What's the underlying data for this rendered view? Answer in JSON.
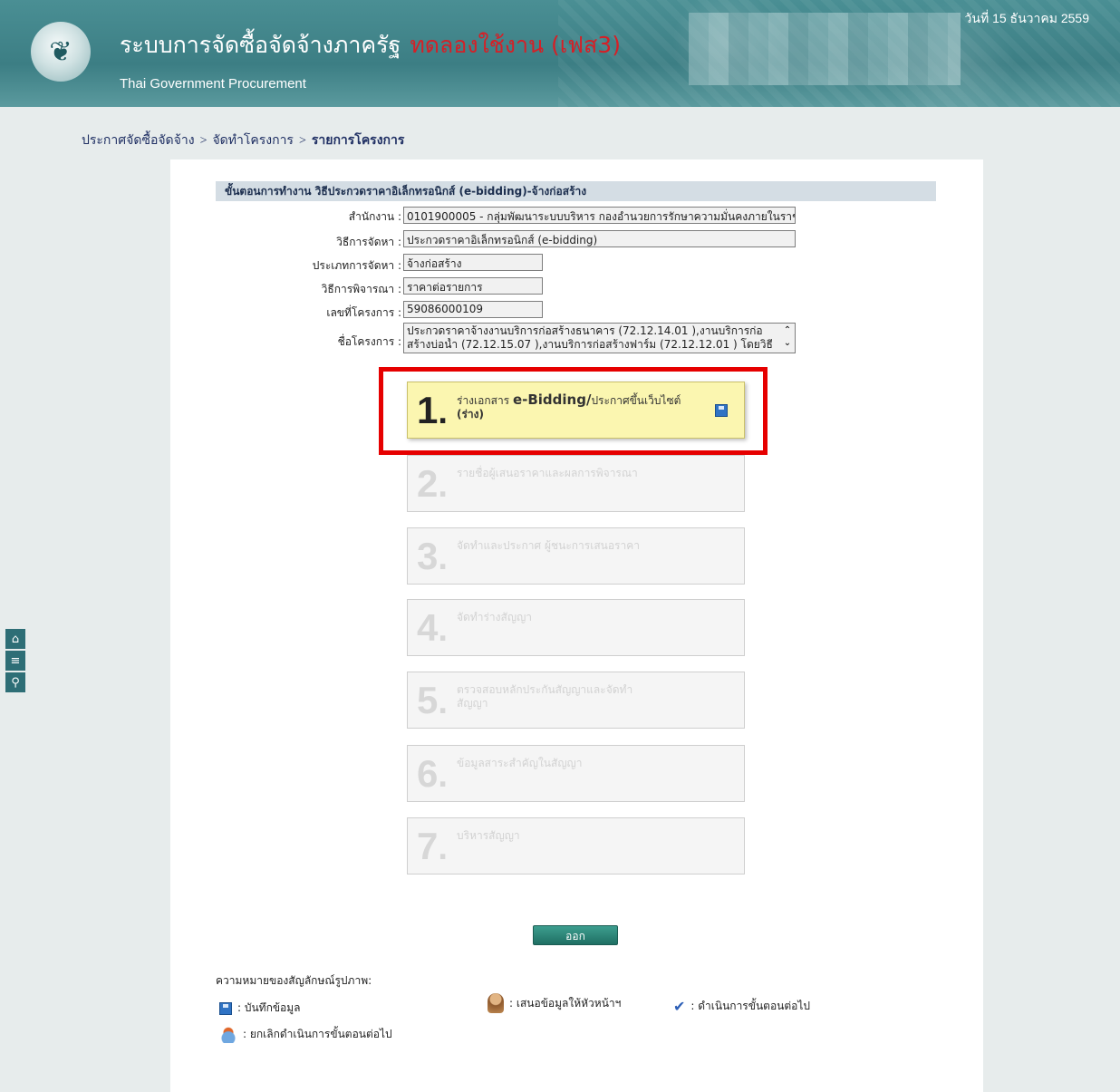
{
  "header": {
    "title_th": "ระบบการจัดซื้อจัดจ้างภาครัฐ",
    "title_trial": "ทดลองใช้งาน (เฟส3)",
    "title_en": "Thai Government Procurement",
    "date": "วันที่ 15 ธันวาคม 2559"
  },
  "breadcrumb": {
    "items": [
      "ประกาศจัดซื้อจัดจ้าง",
      "จัดทำโครงการ",
      "รายการโครงการ"
    ],
    "separator": ">"
  },
  "sidebar": {
    "icons": [
      "home-icon",
      "menu-icon",
      "search-icon"
    ],
    "home_glyph": "⌂",
    "menu_glyph": "≡",
    "search_glyph": "⚲"
  },
  "section": {
    "heading": "ขั้นตอนการทำงาน วิธีประกวดราคาอิเล็กทรอนิกส์ (e-bidding)-จ้างก่อสร้าง"
  },
  "form": {
    "agency_label": "สำนักงาน :",
    "agency_value": "0101900005 - กลุ่มพัฒนาระบบบริหาร กองอำนวยการรักษาความมั่นคงภายในราช",
    "method_label": "วิธีการจัดหา :",
    "method_value": "ประกวดราคาอิเล็กทรอนิกส์ (e-bidding)",
    "type_label": "ประเภทการจัดหา :",
    "type_value": "จ้างก่อสร้าง",
    "consider_label": "วิธีการพิจารณา :",
    "consider_value": "ราคาต่อรายการ",
    "project_no_label": "เลขที่โครงการ :",
    "project_no_value": "59086000109",
    "project_name_label": "ชื่อโครงการ :",
    "project_name_line1": "ประกวดราคาจ้างงานบริการก่อสร้างธนาคาร (72.12.14.01 ),งานบริการก่อ",
    "project_name_line2": "สร้างบ่อน้ำ (72.12.15.07 ),งานบริการก่อสร้างฟาร์ม (72.12.12.01 ) โดยวิธี",
    "scroll_up": "⌃",
    "scroll_down": "⌄"
  },
  "steps": [
    {
      "num": "1",
      "dot": ".",
      "label_small": "ร่างเอกสาร ",
      "label_big": "e-Bidding/",
      "label_rest": "ประกาศขึ้นเว็บไซต์",
      "sub": "(ร่าง)",
      "state": "active"
    },
    {
      "num": "2",
      "dot": ".",
      "label": "รายชื่อผู้เสนอราคาและผลการพิจารณา",
      "state": "disabled"
    },
    {
      "num": "3",
      "dot": ".",
      "label": "จัดทำและประกาศ ผู้ชนะการเสนอราคา",
      "state": "disabled"
    },
    {
      "num": "4",
      "dot": ".",
      "label": "จัดทำร่างสัญญา",
      "state": "disabled"
    },
    {
      "num": "5",
      "dot": ".",
      "label": "ตรวจสอบหลักประกันสัญญาและจัดทำสัญญา",
      "state": "disabled"
    },
    {
      "num": "6",
      "dot": ".",
      "label": "ข้อมูลสาระสำคัญในสัญญา",
      "state": "disabled"
    },
    {
      "num": "7",
      "dot": ".",
      "label": "บริหารสัญญา",
      "state": "disabled"
    }
  ],
  "exit_button": "ออก",
  "legend": {
    "title": "ความหมายของสัญลักษณ์รูปภาพ:",
    "save": ": บันทึกข้อมูล",
    "submit_head": ": เสนอข้อมูลให้หัวหน้าฯ",
    "proceed": ": ดำเนินการขั้นตอนต่อไป",
    "cancel": ": ยกเลิกดำเนินการขั้นตอนต่อไป",
    "check_glyph": "✔"
  },
  "colors": {
    "header_bg": "#3c7e84",
    "trial_red": "#d61f26",
    "highlight_red": "#e60000",
    "active_step_bg": "#fbf6b0",
    "exit_button_bg": "#1f6f63"
  }
}
